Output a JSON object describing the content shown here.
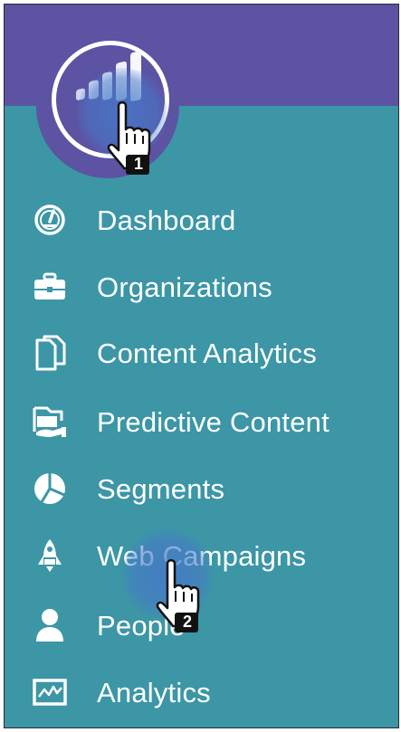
{
  "sidebar": {
    "colors": {
      "header": "#5c53a3",
      "background": "#3c96a6",
      "text": "#ffffff"
    },
    "logo": {
      "icon": "bar-chart-logo-icon"
    },
    "items": [
      {
        "label": "Dashboard",
        "icon": "speedometer-icon"
      },
      {
        "label": "Organizations",
        "icon": "briefcase-icon"
      },
      {
        "label": "Content Analytics",
        "icon": "documents-icon"
      },
      {
        "label": "Predictive Content",
        "icon": "folder-hand-icon"
      },
      {
        "label": "Segments",
        "icon": "pie-chart-icon"
      },
      {
        "label": "Web Campaigns",
        "icon": "rocket-icon"
      },
      {
        "label": "People",
        "icon": "person-icon"
      },
      {
        "label": "Analytics",
        "icon": "line-chart-icon"
      }
    ]
  },
  "annotations": [
    {
      "step": "1",
      "icon": "hand-cursor-icon"
    },
    {
      "step": "2",
      "icon": "hand-cursor-icon"
    }
  ]
}
